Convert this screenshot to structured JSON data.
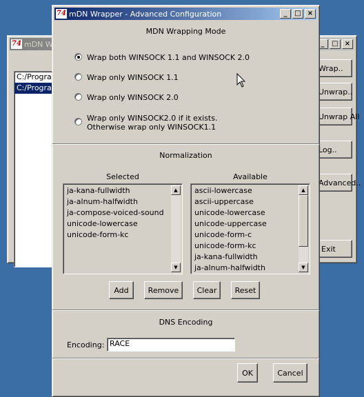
{
  "back_window": {
    "title": "mDN Wrapper",
    "list_items": [
      "C:/Program",
      "C:/Program"
    ],
    "buttons": [
      "Wrap..",
      "Unwrap..",
      "Unwrap All",
      "Log..",
      "Advanced..",
      "Exit"
    ]
  },
  "dialog": {
    "title": "mDN Wrapper - Advanced Configuration",
    "wrap_section": {
      "heading": "MDN Wrapping Mode",
      "options": [
        {
          "label": "Wrap both WINSOCK 1.1 and WINSOCK 2.0",
          "selected": true
        },
        {
          "label": "Wrap only WINSOCK 1.1",
          "selected": false
        },
        {
          "label": "Wrap only WINSOCK 2.0",
          "selected": false
        },
        {
          "line1": "Wrap only WINSOCK2.0 if it exists.",
          "line2": "Otherwise wrap only WINSOCK1.1",
          "selected": false
        }
      ]
    },
    "normalization": {
      "heading": "Normalization",
      "selected_label": "Selected",
      "available_label": "Available",
      "selected_items": [
        "ja-kana-fullwidth",
        "ja-alnum-halfwidth",
        "ja-compose-voiced-sound",
        "unicode-lowercase",
        "unicode-form-kc"
      ],
      "available_items": [
        "ascii-lowercase",
        "ascii-uppercase",
        "unicode-lowercase",
        "unicode-uppercase",
        "unicode-form-c",
        "unicode-form-kc",
        "ja-kana-fullwidth",
        "ja-alnum-halfwidth"
      ],
      "buttons": {
        "add": "Add",
        "remove": "Remove",
        "clear": "Clear",
        "reset": "Reset"
      }
    },
    "dns": {
      "heading": "DNS Encoding",
      "encoding_label": "Encoding:",
      "encoding_value": "RACE"
    },
    "ok_label": "OK",
    "cancel_label": "Cancel"
  }
}
